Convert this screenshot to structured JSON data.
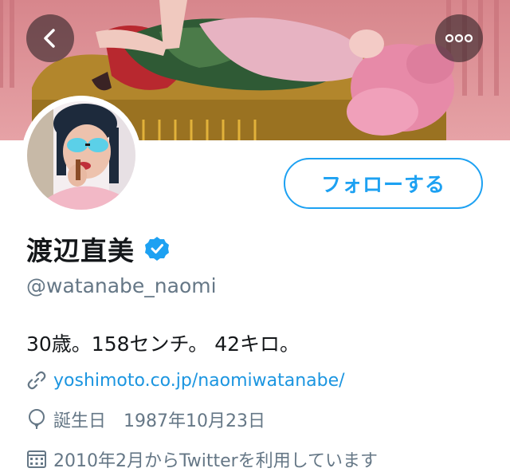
{
  "header": {
    "back_icon": "chevron-left-icon",
    "more_icon": "more-horizontal-icon"
  },
  "profile": {
    "display_name": "渡辺直美",
    "verified_icon": "verified-badge-icon",
    "handle": "@watanabe_naomi",
    "follow_label": "フォローする",
    "bio": "30歳。158センチ。 42キロ。",
    "link": "yoshimoto.co.jp/naomiwatanabe/",
    "link_icon": "link-icon",
    "birth_label": "誕生日",
    "birth_date": "1987年10月23日",
    "birth_icon": "balloon-icon",
    "joined": "2010年2月からTwitterを利用しています",
    "joined_icon": "calendar-icon"
  },
  "colors": {
    "accent": "#1da1f2",
    "link": "#1b95e0",
    "secondary_text": "#657786",
    "primary_text": "#14171a"
  }
}
